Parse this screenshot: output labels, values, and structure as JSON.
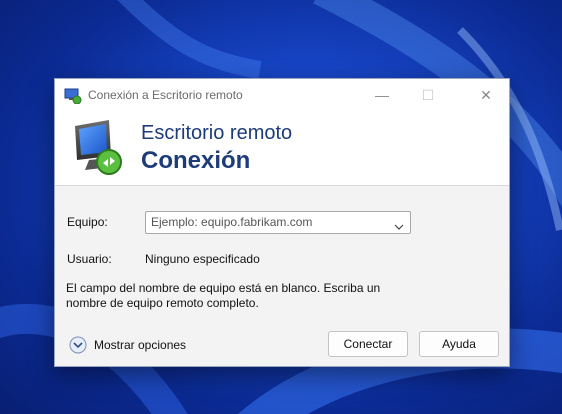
{
  "window": {
    "title": "Conexión a Escritorio remoto",
    "minimize_glyph": "—",
    "maximize_glyph": "☐",
    "close_glyph": "✕"
  },
  "banner": {
    "line1": "Escritorio remoto",
    "line2": "Conexión"
  },
  "form": {
    "computer_label": "Equipo:",
    "computer_placeholder": "Ejemplo: equipo.fabrikam.com",
    "user_label": "Usuario:",
    "user_value": "Ninguno especificado",
    "message": "El campo del nombre de equipo está en blanco. Escriba un nombre de equipo remoto completo."
  },
  "footer": {
    "options_label": "Mostrar opciones",
    "connect_label": "Conectar",
    "help_label": "Ayuda"
  },
  "icons": {
    "app": "remote-desktop-icon",
    "options": "chevron-down-circle-icon",
    "combo": "chevron-down-icon"
  },
  "colors": {
    "banner_text": "#1e3c78",
    "wallpaper": "#1746c8"
  }
}
